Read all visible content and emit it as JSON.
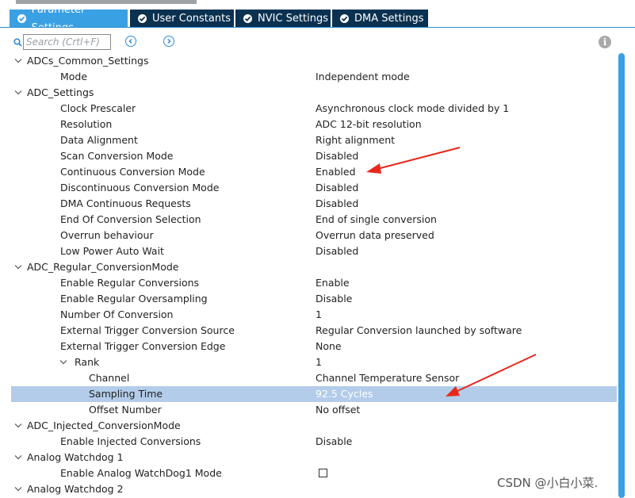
{
  "tabs": [
    {
      "label": "Parameter Settings",
      "active": true
    },
    {
      "label": "User Constants",
      "active": false
    },
    {
      "label": "NVIC Settings",
      "active": false
    },
    {
      "label": "DMA Settings",
      "active": false
    }
  ],
  "search": {
    "placeholder": "Search (Crtl+F)"
  },
  "icons": {
    "search": "search-icon",
    "prev": "chevron-left-icon",
    "next": "chevron-right-icon",
    "info": "info-icon",
    "info_glyph": "i"
  },
  "colors": {
    "tab_active": "#3aa0e4",
    "tab_inactive": "#0b3150",
    "selection": "#b3ccea",
    "annotation_arrow": "#e8281c"
  },
  "tree": [
    {
      "level": 0,
      "expandable": true,
      "name": "ADCs_Common_Settings"
    },
    {
      "level": 1,
      "name": "Mode",
      "value": "Independent mode"
    },
    {
      "level": 0,
      "expandable": true,
      "name": "ADC_Settings"
    },
    {
      "level": 1,
      "name": "Clock Prescaler",
      "value": "Asynchronous clock mode divided by 1"
    },
    {
      "level": 1,
      "name": "Resolution",
      "value": "ADC 12-bit resolution"
    },
    {
      "level": 1,
      "name": "Data Alignment",
      "value": "Right alignment"
    },
    {
      "level": 1,
      "name": "Scan Conversion Mode",
      "value": "Disabled"
    },
    {
      "level": 1,
      "name": "Continuous Conversion Mode",
      "value": "Enabled"
    },
    {
      "level": 1,
      "name": "Discontinuous Conversion Mode",
      "value": "Disabled"
    },
    {
      "level": 1,
      "name": "DMA Continuous Requests",
      "value": "Disabled"
    },
    {
      "level": 1,
      "name": "End Of Conversion Selection",
      "value": "End of single conversion"
    },
    {
      "level": 1,
      "name": "Overrun behaviour",
      "value": "Overrun data preserved"
    },
    {
      "level": 1,
      "name": "Low Power Auto Wait",
      "value": "Disabled"
    },
    {
      "level": 0,
      "expandable": true,
      "name": "ADC_Regular_ConversionMode"
    },
    {
      "level": 1,
      "name": "Enable Regular Conversions",
      "value": "Enable"
    },
    {
      "level": 1,
      "name": "Enable Regular Oversampling",
      "value": "Disable"
    },
    {
      "level": 1,
      "name": "Number Of Conversion",
      "value": "1"
    },
    {
      "level": 1,
      "name": "External Trigger Conversion Source",
      "value": "Regular Conversion launched by software"
    },
    {
      "level": 1,
      "name": "External Trigger Conversion Edge",
      "value": "None"
    },
    {
      "level": 2,
      "expandable": true,
      "name": "Rank",
      "value": "1"
    },
    {
      "level": 3,
      "name": "Channel",
      "value": "Channel Temperature Sensor"
    },
    {
      "level": 3,
      "name": "Sampling Time",
      "value": "92.5 Cycles",
      "selected": true
    },
    {
      "level": 3,
      "name": "Offset Number",
      "value": "No offset"
    },
    {
      "level": 0,
      "expandable": true,
      "name": "ADC_Injected_ConversionMode"
    },
    {
      "level": 1,
      "name": "Enable Injected Conversions",
      "value": "Disable"
    },
    {
      "level": 0,
      "expandable": true,
      "name": "Analog Watchdog 1"
    },
    {
      "level": 1,
      "name": "Enable Analog WatchDog1 Mode",
      "checkbox": true,
      "checked": false
    },
    {
      "level": 0,
      "expandable": true,
      "name": "Analog Watchdog 2"
    }
  ],
  "watermark": "CSDN @小白小菜."
}
